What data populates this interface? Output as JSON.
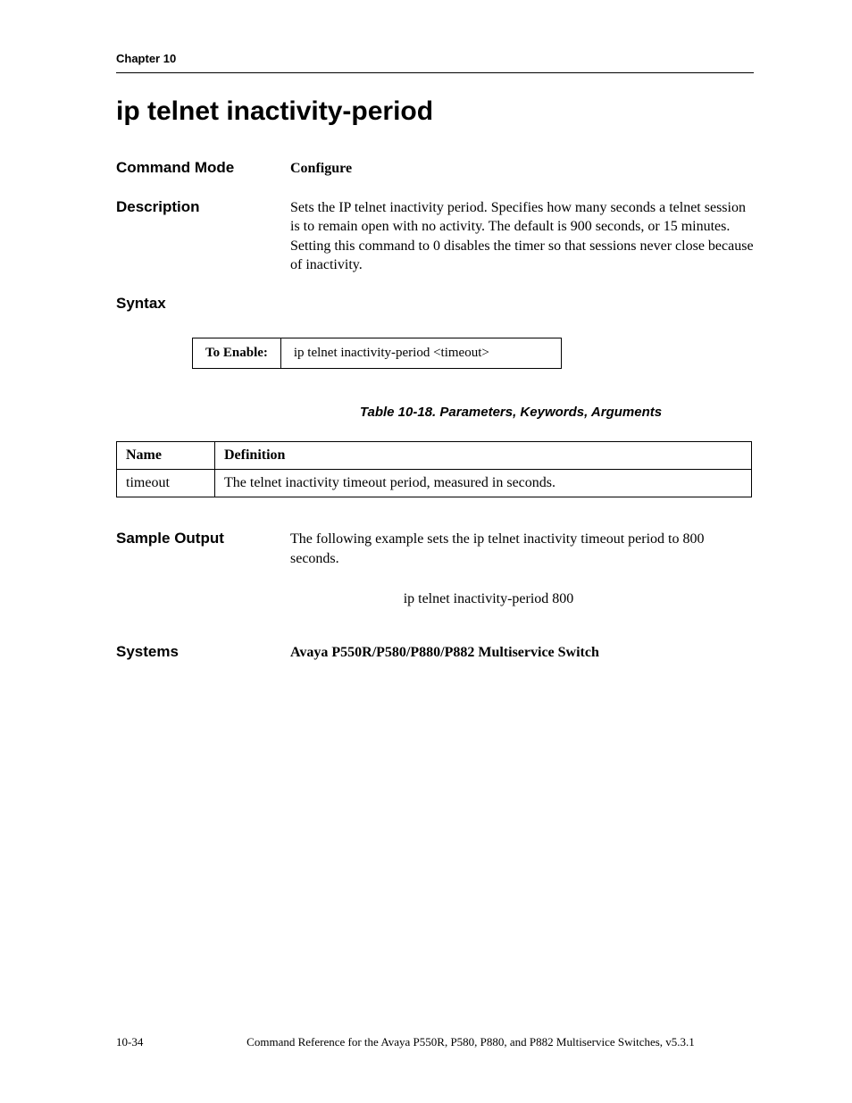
{
  "header": {
    "chapter": "Chapter 10"
  },
  "title": "ip telnet inactivity-period",
  "sections": {
    "command_mode": {
      "label": "Command Mode",
      "value": "Configure"
    },
    "description": {
      "label": "Description",
      "value": "Sets the IP telnet inactivity period. Specifies how many seconds a telnet session is to remain open with no activity. The default is 900 seconds, or 15 minutes. Setting this command to 0 disables the timer so that sessions never close because of inactivity."
    },
    "syntax": {
      "label": "Syntax",
      "to_enable_label": "To Enable:",
      "to_enable_value": "ip telnet inactivity-period <timeout>"
    },
    "table_caption": "Table 10-18.  Parameters, Keywords, Arguments",
    "params_table": {
      "headers": {
        "name": "Name",
        "definition": "Definition"
      },
      "rows": [
        {
          "name": "timeout",
          "definition": "The telnet inactivity timeout period, measured in seconds."
        }
      ]
    },
    "sample_output": {
      "label": "Sample Output",
      "value": "The following example sets the ip telnet inactivity timeout period to 800 seconds.",
      "command": "ip telnet inactivity-period 800"
    },
    "systems": {
      "label": "Systems",
      "value": "Avaya P550R/P580/P880/P882 Multiservice Switch"
    }
  },
  "footer": {
    "page": "10-34",
    "text": "Command Reference for the Avaya P550R, P580, P880, and P882 Multiservice Switches, v5.3.1"
  }
}
